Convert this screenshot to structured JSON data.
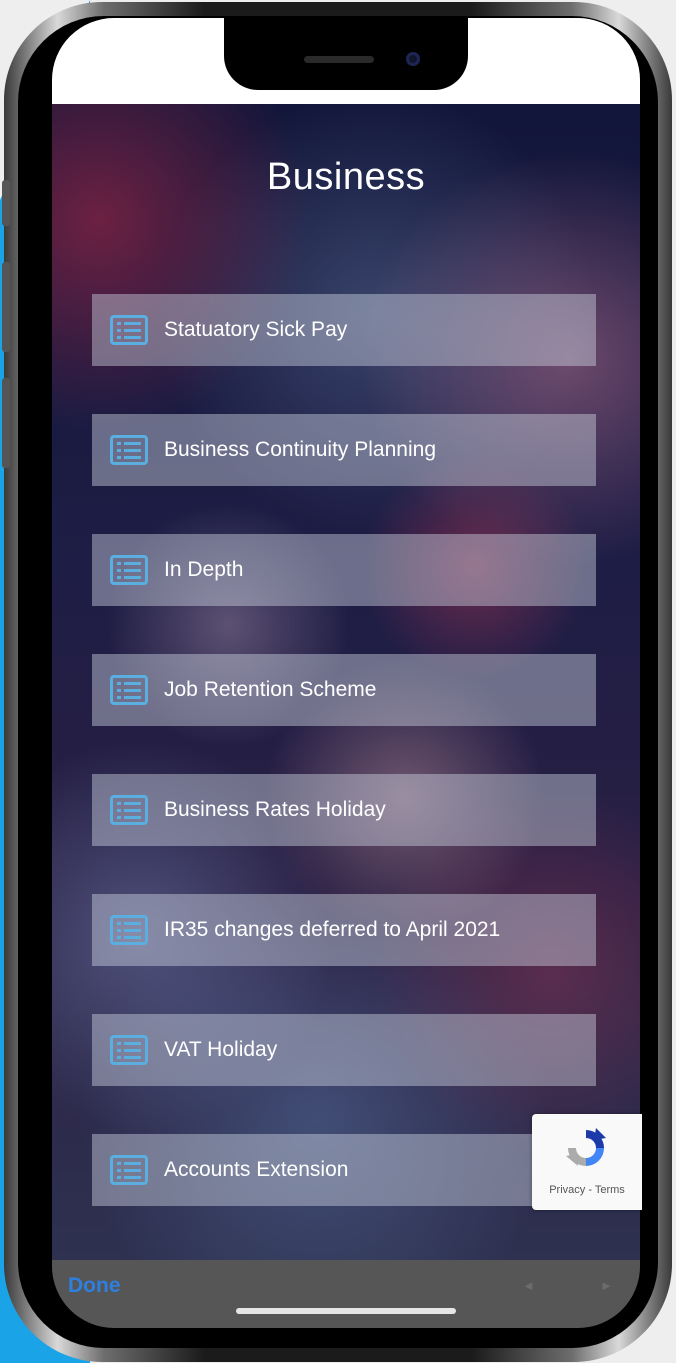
{
  "page": {
    "title": "Business"
  },
  "menu": {
    "items": [
      {
        "label": "Statuatory Sick Pay",
        "icon": "list-icon"
      },
      {
        "label": "Business Continuity Planning",
        "icon": "list-icon"
      },
      {
        "label": "In Depth",
        "icon": "list-icon"
      },
      {
        "label": "Job Retention Scheme",
        "icon": "list-icon"
      },
      {
        "label": "Business Rates Holiday",
        "icon": "list-icon"
      },
      {
        "label": "IR35 changes deferred to April 2021",
        "icon": "list-icon"
      },
      {
        "label": "VAT Holiday",
        "icon": "list-icon"
      },
      {
        "label": "Accounts Extension",
        "icon": "list-icon"
      }
    ]
  },
  "recaptcha": {
    "text": "Privacy - Terms",
    "icon": "recaptcha-icon"
  },
  "toolbar": {
    "done_label": "Done",
    "prev_icon": "◄",
    "next_icon": "►"
  },
  "colors": {
    "accent": "#2d7fe0",
    "icon_blue": "#5aaee0",
    "background_blue": "#1aa3e6"
  }
}
